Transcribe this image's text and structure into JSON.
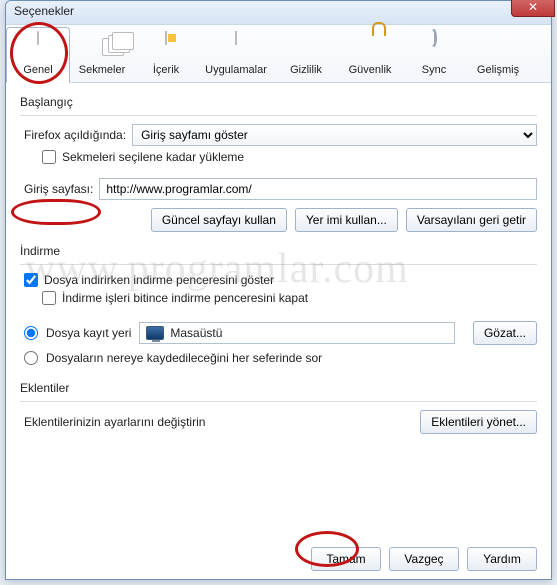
{
  "window": {
    "title": "Seçenekler"
  },
  "tabs": [
    {
      "label": "Genel",
      "icon": "general-icon",
      "selected": true
    },
    {
      "label": "Sekmeler",
      "icon": "tabs-icon",
      "selected": false
    },
    {
      "label": "İçerik",
      "icon": "content-icon",
      "selected": false
    },
    {
      "label": "Uygulamalar",
      "icon": "apps-icon",
      "selected": false
    },
    {
      "label": "Gizlilik",
      "icon": "privacy-icon",
      "selected": false
    },
    {
      "label": "Güvenlik",
      "icon": "security-icon",
      "selected": false
    },
    {
      "label": "Sync",
      "icon": "sync-icon",
      "selected": false
    },
    {
      "label": "Gelişmiş",
      "icon": "advanced-icon",
      "selected": false
    }
  ],
  "startup": {
    "heading": "Başlangıç",
    "open_label": "Firefox açıldığında:",
    "open_value": "Giriş sayfamı göster",
    "tabs_until_selected_label": "Sekmeleri seçilene kadar yükleme",
    "tabs_until_selected_checked": false,
    "home_label": "Giriş sayfası:",
    "home_value": "http://www.programlar.com/",
    "btn_current": "Güncel sayfayı kullan",
    "btn_bookmark": "Yer imi kullan...",
    "btn_restore": "Varsayılanı geri getir"
  },
  "downloads": {
    "heading": "İndirme",
    "show_window_label": "Dosya indirirken indirme penceresini göster",
    "show_window_checked": true,
    "close_done_label": "İndirme işleri bitince indirme penceresini kapat",
    "close_done_checked": false,
    "save_to_radio_label": "Dosya kayıt yeri",
    "save_to_radio_checked": true,
    "save_location": "Masaüstü",
    "browse_btn": "Gözat...",
    "ask_radio_label": "Dosyaların nereye kaydedileceğini her seferinde sor",
    "ask_radio_checked": false
  },
  "addons": {
    "heading": "Eklentiler",
    "sub": "Eklentilerinizin ayarlarını değiştirin",
    "btn_manage": "Eklentileri yönet..."
  },
  "footer": {
    "ok": "Tamam",
    "cancel": "Vazgeç",
    "help": "Yardım"
  },
  "watermark": "www.programlar.com"
}
